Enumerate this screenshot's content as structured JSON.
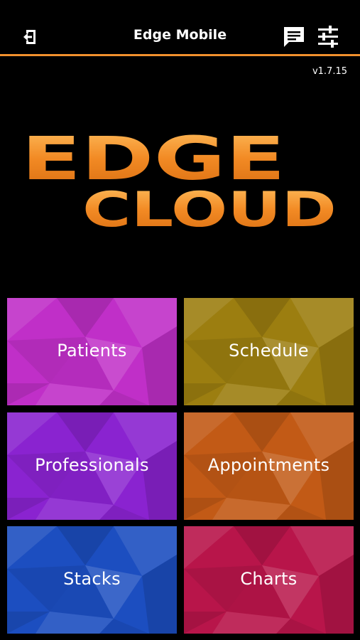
{
  "header": {
    "title": "Edge Mobile",
    "accent_color": "#f2902d",
    "logout_icon": "logout-icon",
    "chat_icon": "chat-icon",
    "settings_icon": "sliders-icon"
  },
  "version": "v1.7.15",
  "logo": {
    "line1": "EDGE",
    "line2": "CLOUD",
    "color": "#f08a22"
  },
  "tiles": [
    {
      "label": "Patients",
      "color": "#c02fc8"
    },
    {
      "label": "Schedule",
      "color": "#9c7e10"
    },
    {
      "label": "Professionals",
      "color": "#8a23d0"
    },
    {
      "label": "Appointments",
      "color": "#c25a16"
    },
    {
      "label": "Stacks",
      "color": "#1c4ec0"
    },
    {
      "label": "Charts",
      "color": "#b8154a"
    }
  ]
}
